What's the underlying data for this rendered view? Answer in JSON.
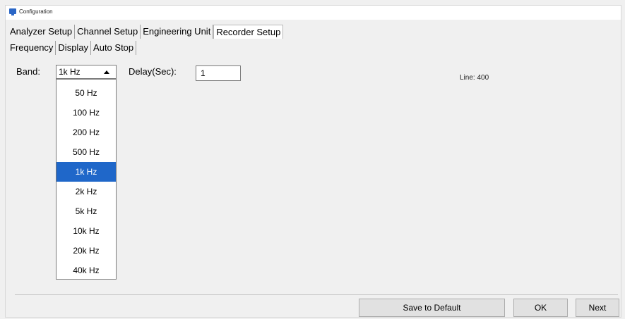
{
  "window": {
    "title": "Configuration"
  },
  "tabs_primary": [
    {
      "label": "Analyzer Setup"
    },
    {
      "label": "Channel Setup"
    },
    {
      "label": "Engineering Unit"
    },
    {
      "label": "Recorder Setup"
    }
  ],
  "tabs_secondary": [
    {
      "label": "Frequency"
    },
    {
      "label": "Display"
    },
    {
      "label": "Auto Stop"
    }
  ],
  "band": {
    "label": "Band:",
    "selected": "1k Hz",
    "options": [
      "50 Hz",
      "100 Hz",
      "200 Hz",
      "500 Hz",
      "1k Hz",
      "2k Hz",
      "5k Hz",
      "10k Hz",
      "20k Hz",
      "40k Hz"
    ]
  },
  "delay": {
    "label": "Delay(Sec):",
    "value": "1"
  },
  "line_info": "Line: 400",
  "buttons": {
    "save_default": "Save to Default",
    "ok": "OK",
    "next": "Next"
  },
  "colors": {
    "selection": "#1f67c9",
    "app_icon": "#2a66c6"
  }
}
